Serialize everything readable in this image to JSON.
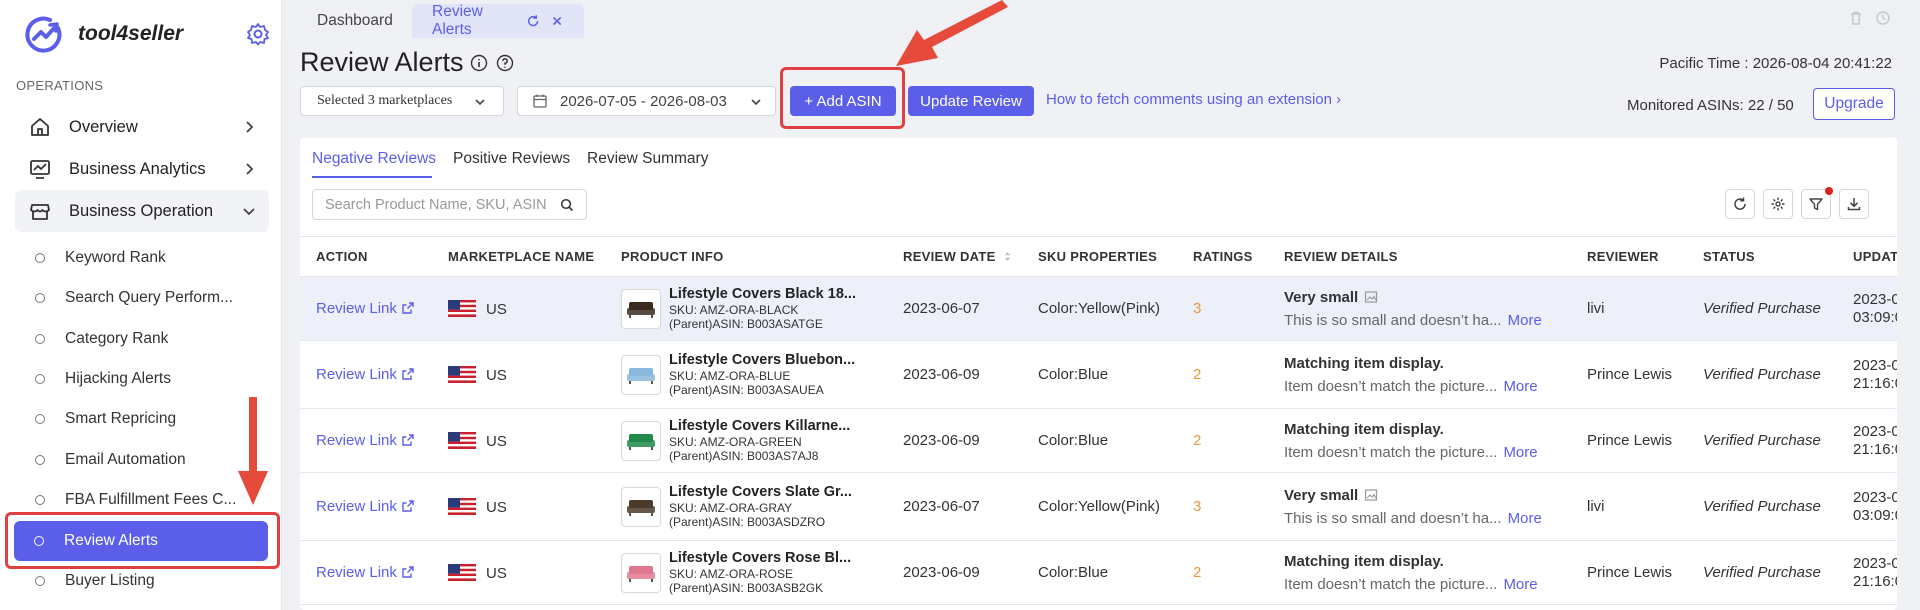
{
  "sidebar": {
    "brand": "tool4seller",
    "section_label": "OPERATIONS",
    "menus": [
      {
        "label": "Overview"
      },
      {
        "label": "Business Analytics"
      },
      {
        "label": "Business Operation"
      }
    ],
    "items": [
      {
        "label": "Keyword Rank"
      },
      {
        "label": "Search Query Perform..."
      },
      {
        "label": "Category Rank"
      },
      {
        "label": "Hijacking Alerts"
      },
      {
        "label": "Smart Repricing"
      },
      {
        "label": "Email Automation"
      },
      {
        "label": "FBA Fulfillment Fees C..."
      },
      {
        "label": "Review Alerts"
      },
      {
        "label": "Buyer Listing"
      }
    ]
  },
  "tabs": [
    {
      "label": "Dashboard"
    },
    {
      "label": "Review Alerts"
    }
  ],
  "header": {
    "title": "Review Alerts",
    "pacific_time": "Pacific Time :  2026-08-04 20:41:22",
    "marketplace_select": "Selected 3 marketplaces",
    "date_range": "2026-07-05 - 2026-08-03",
    "add_asin": "+ Add ASIN",
    "update_review": "Update Review",
    "fetch_link": "How to fetch comments using an extension ›",
    "monitored": "Monitored ASINs: 22 / 50",
    "upgrade": "Upgrade"
  },
  "subtabs": [
    {
      "label": "Negative Reviews"
    },
    {
      "label": "Positive Reviews"
    },
    {
      "label": "Review Summary"
    }
  ],
  "search": {
    "placeholder": "Search Product Name, SKU, ASIN"
  },
  "table": {
    "columns": [
      "ACTION",
      "MARKETPLACE NAME",
      "PRODUCT INFO",
      "REVIEW DATE",
      "SKU PROPERTIES",
      "RATINGS",
      "REVIEW DETAILS",
      "REVIEWER",
      "STATUS",
      "UPDAT"
    ],
    "rows": [
      {
        "action": "Review Link",
        "market": "US",
        "name": "Lifestyle Covers Black 18...",
        "sku": "SKU: AMZ-ORA-BLACK",
        "asin": "(Parent)ASIN: B003ASATGE",
        "thumb_color": "#3a2a1c",
        "date": "2023-06-07",
        "props": "Color:Yellow(Pink)",
        "rating": "3",
        "title": "Very small",
        "has_img": true,
        "text": "This is so small and doesn’t ha...",
        "more": "More",
        "reviewer": "livi",
        "status": "Verified Purchase",
        "upd1": "2023-0",
        "upd2": "03:09:0"
      },
      {
        "action": "Review Link",
        "market": "US",
        "name": "Lifestyle Covers Bluebon...",
        "sku": "SKU: AMZ-ORA-BLUE",
        "asin": "(Parent)ASIN: B003ASAUEA",
        "thumb_color": "#8ab8dc",
        "date": "2023-06-09",
        "props": "Color:Blue",
        "rating": "2",
        "title": "Matching item display.",
        "has_img": false,
        "text": "Item doesn’t match the picture...",
        "more": "More",
        "reviewer": "Prince Lewis",
        "status": "Verified Purchase",
        "upd1": "2023-0",
        "upd2": "21:16:0"
      },
      {
        "action": "Review Link",
        "market": "US",
        "name": "Lifestyle Covers Killarne...",
        "sku": "SKU: AMZ-ORA-GREEN",
        "asin": "(Parent)ASIN: B003AS7AJ8",
        "thumb_color": "#1f8a4a",
        "date": "2023-06-09",
        "props": "Color:Blue",
        "rating": "2",
        "title": "Matching item display.",
        "has_img": false,
        "text": "Item doesn’t match the picture...",
        "more": "More",
        "reviewer": "Prince Lewis",
        "status": "Verified Purchase",
        "upd1": "2023-0",
        "upd2": "21:16:0"
      },
      {
        "action": "Review Link",
        "market": "US",
        "name": "Lifestyle Covers Slate Gr...",
        "sku": "SKU: AMZ-ORA-GRAY",
        "asin": "(Parent)ASIN: B003ASDZRO",
        "thumb_color": "#4a3a2a",
        "date": "2023-06-07",
        "props": "Color:Yellow(Pink)",
        "rating": "3",
        "title": "Very small",
        "has_img": true,
        "text": "This is so small and doesn’t ha...",
        "more": "More",
        "reviewer": "livi",
        "status": "Verified Purchase",
        "upd1": "2023-0",
        "upd2": "03:09:0"
      },
      {
        "action": "Review Link",
        "market": "US",
        "name": "Lifestyle Covers Rose Bl...",
        "sku": "SKU: AMZ-ORA-ROSE",
        "asin": "(Parent)ASIN: B003ASB2GK",
        "thumb_color": "#e07890",
        "date": "2023-06-09",
        "props": "Color:Blue",
        "rating": "2",
        "title": "Matching item display.",
        "has_img": false,
        "text": "Item doesn’t match the picture...",
        "more": "More",
        "reviewer": "Prince Lewis",
        "status": "Verified Purchase",
        "upd1": "2023-0",
        "upd2": "21:16:0"
      }
    ]
  },
  "colors": {
    "accent": "#5b5ee8",
    "highlight": "#e04040",
    "rating": "#e89a3a"
  }
}
